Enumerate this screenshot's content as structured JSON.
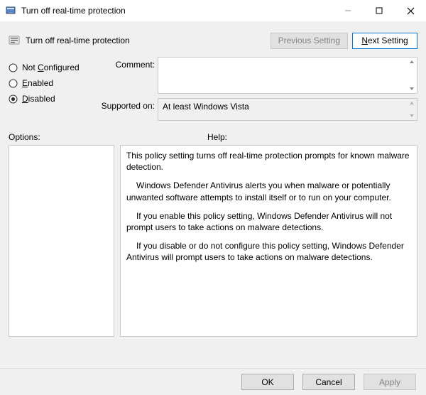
{
  "window": {
    "title": "Turn off real-time protection"
  },
  "header": {
    "policy_name": "Turn off real-time protection",
    "prev_btn": "Previous Setting",
    "next_btn_prefix": "N",
    "next_btn_rest": "ext Setting"
  },
  "radios": {
    "not_configured": {
      "pre": "Not ",
      "ul": "C",
      "post": "onfigured",
      "selected": false
    },
    "enabled": {
      "pre": "",
      "ul": "E",
      "post": "nabled",
      "selected": false
    },
    "disabled": {
      "pre": "",
      "ul": "D",
      "post": "isabled",
      "selected": true
    }
  },
  "fields": {
    "comment_label": "Comment:",
    "comment_value": "",
    "supported_label": "Supported on:",
    "supported_value": "At least Windows Vista"
  },
  "lower": {
    "options_label": "Options:",
    "help_label": "Help:"
  },
  "help": {
    "p1": "This policy setting turns off real-time protection prompts for known malware detection.",
    "p2": "Windows Defender Antivirus alerts you when malware or potentially unwanted software attempts to install itself or to run on your computer.",
    "p3": "If you enable this policy setting, Windows Defender Antivirus will not prompt users to take actions on malware detections.",
    "p4": "If you disable or do not configure this policy setting, Windows Defender Antivirus will prompt users to take actions on malware detections."
  },
  "footer": {
    "ok": "OK",
    "cancel": "Cancel",
    "apply": "Apply"
  }
}
